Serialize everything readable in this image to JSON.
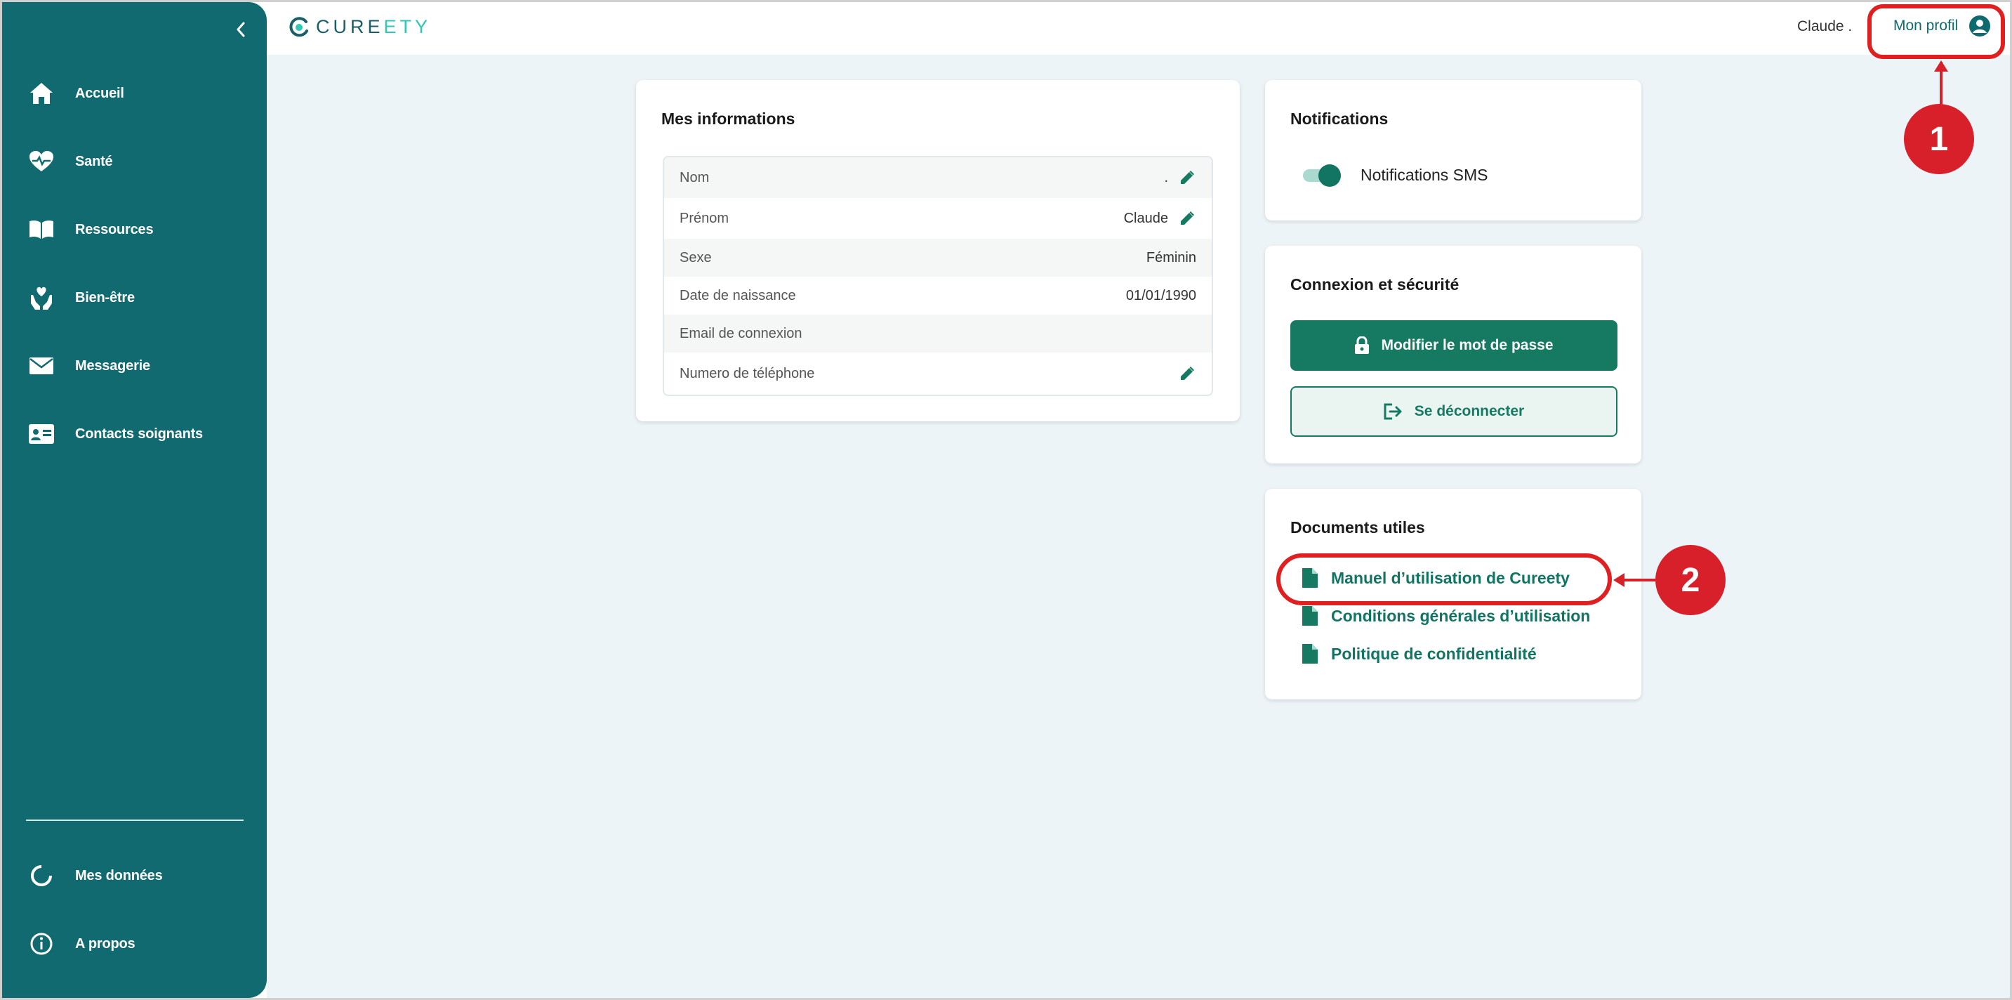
{
  "brand": {
    "logo_text_a": "CURE",
    "logo_text_b": "ETY"
  },
  "sidebar": {
    "items": [
      {
        "label": "Accueil",
        "icon": "home-icon"
      },
      {
        "label": "Santé",
        "icon": "heart-pulse-icon"
      },
      {
        "label": "Ressources",
        "icon": "book-icon"
      },
      {
        "label": "Bien-être",
        "icon": "hands-heart-icon"
      },
      {
        "label": "Messagerie",
        "icon": "envelope-icon"
      },
      {
        "label": "Contacts soignants",
        "icon": "contact-card-icon"
      }
    ],
    "bottom_items": [
      {
        "label": "Mes données",
        "icon": "data-circle-icon"
      },
      {
        "label": "A propos",
        "icon": "info-icon"
      }
    ]
  },
  "header": {
    "username": "Claude .",
    "profile_label": "Mon profil"
  },
  "info_card": {
    "title": "Mes informations",
    "rows": [
      {
        "key": "Nom",
        "value": "."
      },
      {
        "key": "Prénom",
        "value": "Claude"
      },
      {
        "key": "Sexe",
        "value": "Féminin"
      },
      {
        "key": "Date de naissance",
        "value": "01/01/1990"
      },
      {
        "key": "Email de connexion",
        "value": ""
      },
      {
        "key": "Numero de téléphone",
        "value": ""
      }
    ]
  },
  "notifications": {
    "title": "Notifications",
    "sms_label": "Notifications SMS",
    "sms_enabled": true
  },
  "security": {
    "title": "Connexion et sécurité",
    "change_password": "Modifier le mot de passe",
    "logout": "Se déconnecter"
  },
  "documents": {
    "title": "Documents utiles",
    "links": [
      "Manuel d’utilisation de Cureety",
      "Conditions générales d’utilisation",
      "Politique de confidentialité"
    ]
  },
  "annotations": {
    "badge1": "1",
    "badge2": "2",
    "highlight_color": "#e02020"
  },
  "colors": {
    "sidebar": "#116a70",
    "primary": "#167a62",
    "background": "#edf4f7"
  }
}
